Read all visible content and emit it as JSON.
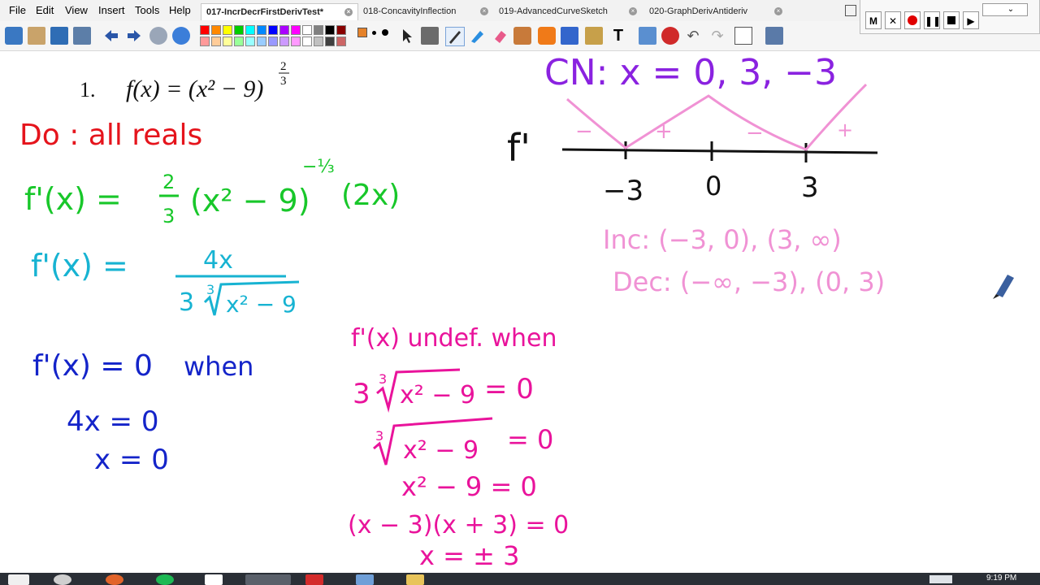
{
  "menu": [
    "File",
    "Edit",
    "View",
    "Insert",
    "Tools",
    "Help"
  ],
  "tabs": [
    {
      "label": "017-IncrDecrFirstDerivTest*",
      "active": true
    },
    {
      "label": "018-ConcavityInflection",
      "active": false
    },
    {
      "label": "019-AdvancedCurveSketch",
      "active": false
    },
    {
      "label": "020-GraphDerivAntideriv",
      "active": false
    }
  ],
  "recorder": {
    "m_label": "M",
    "x_label": "✕"
  },
  "colors": {
    "red": "#e5141c",
    "green": "#18c72a",
    "teal": "#17b3d2",
    "blue": "#1424c9",
    "magenta": "#e9139b",
    "purple": "#8a22e0",
    "pink": "#f092d4",
    "black": "#111111"
  },
  "palette_row1": [
    "#ff0000",
    "#ff8800",
    "#ffff00",
    "#00cc00",
    "#00ffff",
    "#0088ff",
    "#0000ff",
    "#aa00ff",
    "#ff00ff",
    "#ffffff",
    "#808080",
    "#000000",
    "#880000"
  ],
  "palette_row2": [
    "#ff9999",
    "#ffcc99",
    "#ffff99",
    "#99ff99",
    "#99ffff",
    "#99ccff",
    "#9999ff",
    "#cc99ff",
    "#ff99ff",
    "#ffffff",
    "#c0c0c0",
    "#404040",
    "#cc6666"
  ],
  "problem": {
    "number": "1.",
    "equation": "f(x) = (x² − 9)",
    "exponent_num": "2",
    "exponent_den": "3"
  },
  "domain": "Do : all reals",
  "derivative1": {
    "left": "f'(x) =",
    "frac_num": "2",
    "frac_den": "3",
    "base": "(x² − 9)",
    "exponent": "−⅓",
    "tail": "(2x)"
  },
  "derivative2": {
    "left": "f'(x) =",
    "numerator": "4x",
    "coef": "3",
    "index": "3",
    "radicand": "x² − 9"
  },
  "zero_block": {
    "line1": "f'(x) = 0",
    "line1b": "when",
    "line2": "4x = 0",
    "line3": "x = 0"
  },
  "undef_block": {
    "title": "f'(x) undef. when",
    "line1_coef": "3",
    "line1_index": "3",
    "line1_radicand": "x² − 9",
    "line1_rhs": "= 0",
    "line2_index": "3",
    "line2_radicand": "x² − 9",
    "line2_rhs": "= 0",
    "line3": "x² − 9 = 0",
    "line4": "(x − 3)(x + 3) = 0",
    "line5": "x = ± 3"
  },
  "critical": "CN: x = 0, 3, −3",
  "sign_chart": {
    "label": "f'",
    "ticks": [
      "−3",
      "0",
      "3"
    ],
    "signs": [
      "−",
      "+",
      "−",
      "+"
    ]
  },
  "increasing": "Inc: (−3, 0), (3, ∞)",
  "decreasing": "Dec: (−∞, −3), (0, 3)",
  "clock": "9:19 PM"
}
